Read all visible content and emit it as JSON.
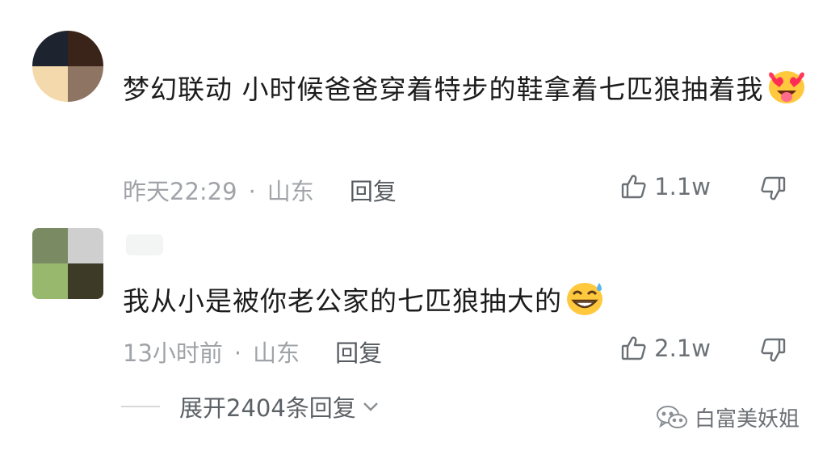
{
  "comments": [
    {
      "text": "梦幻联动 小时候爸爸穿着特步的鞋拿着七匹狼抽着我",
      "emoji": "heart-eyes-tongue-emoji",
      "time": "昨天22:29",
      "location": "山东",
      "reply_label": "回复",
      "likes": "1.1w"
    },
    {
      "text": "我从小是被你老公家的七匹狼抽大的",
      "emoji": "grinning-sweat-emoji",
      "time": "13小时前",
      "location": "山东",
      "reply_label": "回复",
      "likes": "2.1w"
    }
  ],
  "expand_replies": "展开2404条回复",
  "watermark": "白富美妖姐",
  "meta_separator": "·",
  "colors": {
    "meta": "#a0a4a8",
    "text": "#1c1c1c",
    "emoji_yellow": "#ffc83d"
  }
}
